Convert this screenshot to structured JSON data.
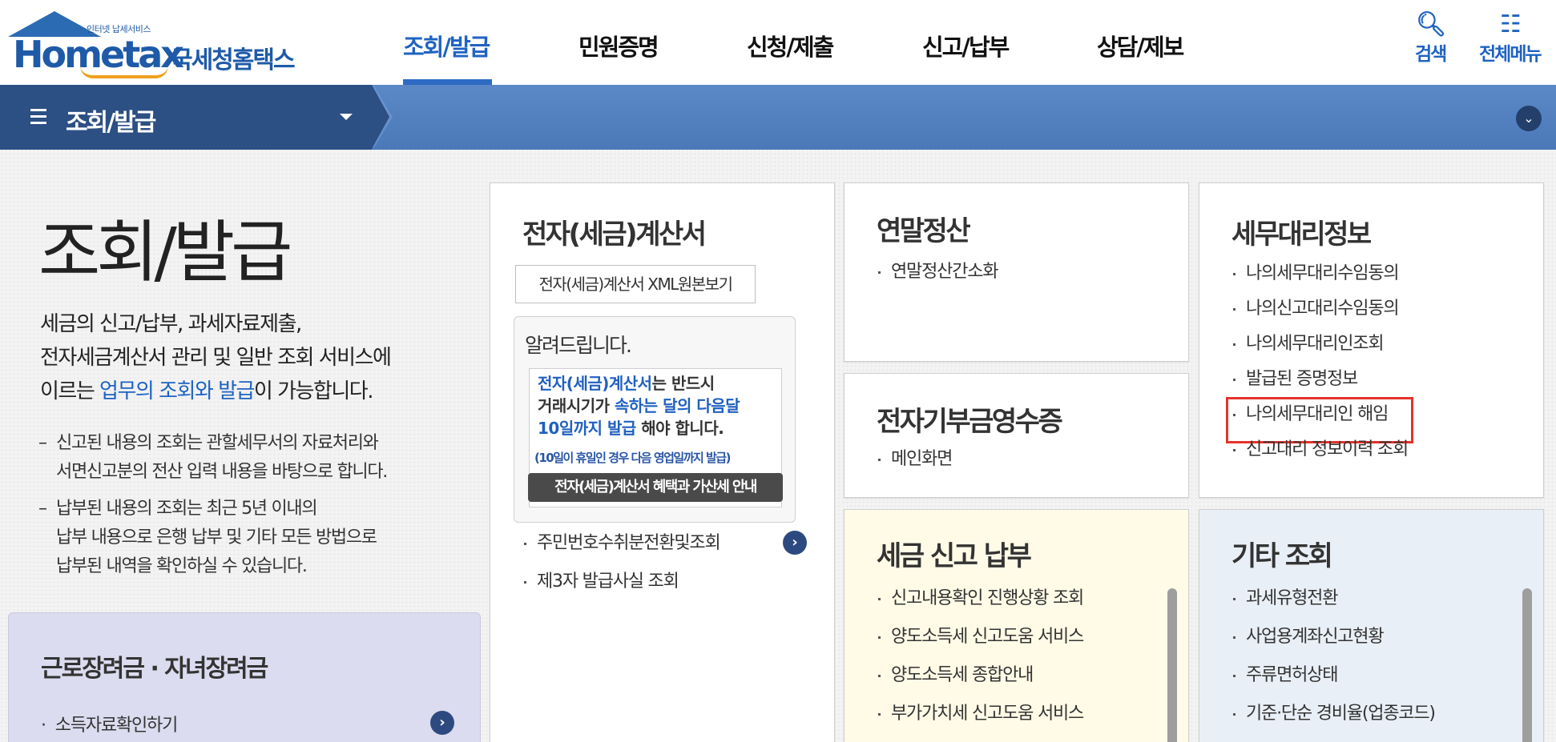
{
  "header": {
    "logo_small": "인터넷 납세서비스",
    "logo_word": "Hometax",
    "logo_kr": "국세청홈택스",
    "nav": [
      "조회/발급",
      "민원증명",
      "신청/제출",
      "신고/납부",
      "상담/제보"
    ],
    "search_label": "검색",
    "menu_label": "전체메뉴",
    "accent": "#1f63c2"
  },
  "subbar": {
    "title": "조회/발급"
  },
  "intro": {
    "title": "조회/발급",
    "desc_1": "세금의 신고/납부, 과세자료제출,",
    "desc_2": "전자세금계산서 관리 및 일반 조회 서비스에",
    "desc_3a": "이르는 ",
    "desc_3b": "업무의 조회와 발급",
    "desc_3c": "이 가능합니다.",
    "note1_a": "신고된 내용의 조회는 관할세무서의 자료처리와",
    "note1_b": "서면신고분의 전산 입력 내용을 바탕으로 합니다.",
    "note2_a": "납부된 내용의 조회는 최근 5년 이내의",
    "note2_b": "납부 내용으로 은행 납부 및 기타 모든 방법으로",
    "note2_c": "납부된 내역을 확인하실 수 있습니다."
  },
  "promo": {
    "title": "근로장려금 · 자녀장려금",
    "item": "소득자료확인하기"
  },
  "einvoice": {
    "title": "전자(세금)계산서",
    "xml_button": "전자(세금)계산서 XML원본보기",
    "notice_title": "알려드립니다.",
    "notice_l1a": "전자(세금)계산서",
    "notice_l1b": "는 반드시",
    "notice_l2a": "거래시기가 ",
    "notice_l2b": "속하는 달의 다음달",
    "notice_l3a": "10일까지 발급",
    "notice_l3b": " 해야 합니다.",
    "notice_small": "(10일이 휴일인 경우 다음 영업일까지 발급)",
    "notice_button": "전자(세금)계산서 혜택과 가산세 안내",
    "items": [
      "주민번호수취분전환및조회",
      "제3자 발급사실 조회"
    ]
  },
  "yearend": {
    "title": "연말정산",
    "items": [
      "연말정산간소화"
    ]
  },
  "donation": {
    "title": "전자기부금영수증",
    "items": [
      "메인화면"
    ]
  },
  "taxagent": {
    "title": "세무대리정보",
    "items": [
      "나의세무대리수임동의",
      "나의신고대리수임동의",
      "나의세무대리인조회",
      "발급된 증명정보",
      "나의세무대리인 해임",
      "신고대리 정보이력 조회"
    ]
  },
  "taxreport": {
    "title": "세금 신고 납부",
    "items": [
      "신고내용확인 진행상황 조회",
      "양도소득세 신고도움 서비스",
      "양도소득세 종합안내",
      "부가가치세 신고도움 서비스"
    ]
  },
  "other": {
    "title": "기타 조회",
    "items": [
      "과세유형전환",
      "사업용계좌신고현황",
      "주류면허상태",
      "기준·단순 경비율(업종코드)"
    ]
  }
}
